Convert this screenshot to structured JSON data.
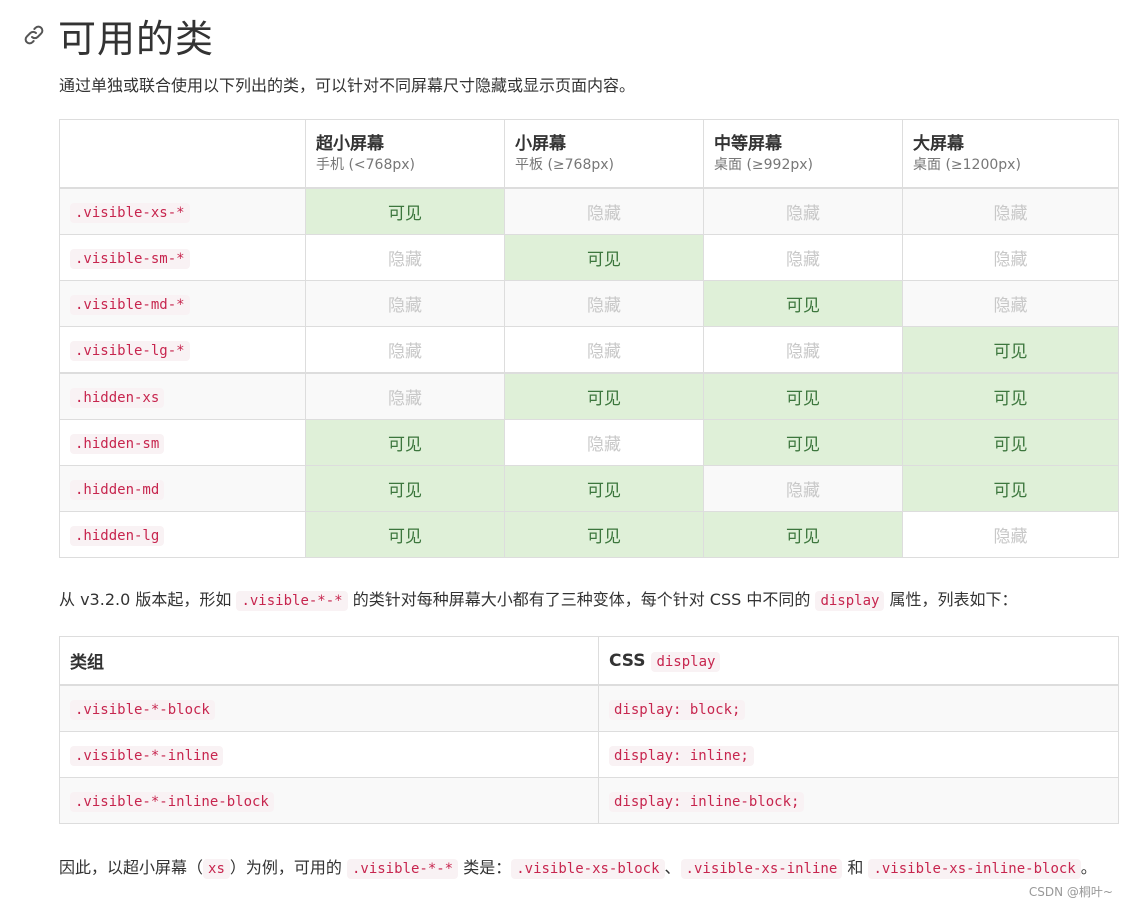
{
  "header": {
    "title": "可用的类",
    "intro": "通过单独或联合使用以下列出的类，可以针对不同屏幕尺寸隐藏或显示页面内容。"
  },
  "table1": {
    "columns": [
      {
        "name": "超小屏幕",
        "sub": "手机 (<768px)"
      },
      {
        "name": "小屏幕",
        "sub": "平板 (≥768px)"
      },
      {
        "name": "中等屏幕",
        "sub": "桌面 (≥992px)"
      },
      {
        "name": "大屏幕",
        "sub": "桌面 (≥1200px)"
      }
    ],
    "visible_label": "可见",
    "hidden_label": "隐藏",
    "rows": [
      {
        "cls": ".visible-xs-*",
        "cells": [
          true,
          false,
          false,
          false
        ]
      },
      {
        "cls": ".visible-sm-*",
        "cells": [
          false,
          true,
          false,
          false
        ]
      },
      {
        "cls": ".visible-md-*",
        "cells": [
          false,
          false,
          true,
          false
        ]
      },
      {
        "cls": ".visible-lg-*",
        "cells": [
          false,
          false,
          false,
          true
        ]
      },
      {
        "cls": ".hidden-xs",
        "cells": [
          false,
          true,
          true,
          true
        ]
      },
      {
        "cls": ".hidden-sm",
        "cells": [
          true,
          false,
          true,
          true
        ]
      },
      {
        "cls": ".hidden-md",
        "cells": [
          true,
          true,
          false,
          true
        ]
      },
      {
        "cls": ".hidden-lg",
        "cells": [
          true,
          true,
          true,
          false
        ]
      }
    ]
  },
  "para2": {
    "t1": "从 v3.2.0 版本起，形如 ",
    "c1": ".visible-*-*",
    "t2": " 的类针对每种屏幕大小都有了三种变体，每个针对 CSS 中不同的 ",
    "c2": "display",
    "t3": " 属性，列表如下："
  },
  "table2": {
    "col1": "类组",
    "col2_text": "CSS ",
    "col2_code": "display",
    "rows": [
      {
        "cls": ".visible-*-block",
        "css": "display: block;"
      },
      {
        "cls": ".visible-*-inline",
        "css": "display: inline;"
      },
      {
        "cls": ".visible-*-inline-block",
        "css": "display: inline-block;"
      }
    ]
  },
  "para3": {
    "t1": "因此，以超小屏幕（",
    "c1": "xs",
    "t2": "）为例，可用的 ",
    "c2": ".visible-*-*",
    "t3": " 类是：",
    "c3": ".visible-xs-block",
    "t4": "、",
    "c4": ".visible-xs-inline",
    "t5": " 和 ",
    "c5": ".visible-xs-inline-block",
    "t6": "。"
  },
  "watermark": "CSDN @桐叶~",
  "colors": {
    "visible_bg": "#dff0d8",
    "visible_text": "#3c763d",
    "hidden_text": "#c8c8c8",
    "code_text": "#c7254e",
    "code_bg": "#f9f2f4"
  }
}
